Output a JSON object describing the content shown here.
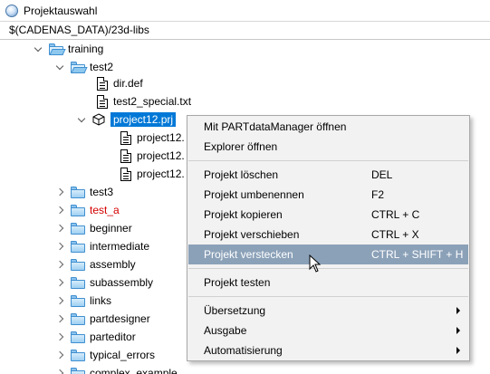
{
  "window": {
    "title": "Projektauswahl"
  },
  "path": "$(CADENAS_DATA)/23d-libs",
  "tree": {
    "training": "training",
    "test2": "test2",
    "files": [
      "dir.def",
      "test2_special.txt"
    ],
    "project": "project12.prj",
    "project_children": [
      "project12.",
      "project12.",
      "project12."
    ],
    "folders_after": [
      {
        "label": "test3",
        "color": "#000000"
      },
      {
        "label": "test_a",
        "color": "#d40000"
      },
      {
        "label": "beginner",
        "color": "#000000"
      },
      {
        "label": "intermediate",
        "color": "#000000"
      },
      {
        "label": "assembly",
        "color": "#000000"
      },
      {
        "label": "subassembly",
        "color": "#000000"
      },
      {
        "label": "links",
        "color": "#000000"
      },
      {
        "label": "partdesigner",
        "color": "#000000"
      },
      {
        "label": "parteditor",
        "color": "#000000"
      },
      {
        "label": "typical_errors",
        "color": "#000000"
      },
      {
        "label": "complex_example",
        "color": "#000000"
      }
    ]
  },
  "context_menu": {
    "group1": [
      {
        "label": "Mit PARTdataManager öffnen",
        "shortcut": ""
      },
      {
        "label": "Explorer öffnen",
        "shortcut": ""
      }
    ],
    "group2": [
      {
        "label": "Projekt löschen",
        "shortcut": "DEL"
      },
      {
        "label": "Projekt umbenennen",
        "shortcut": "F2"
      },
      {
        "label": "Projekt kopieren",
        "shortcut": "CTRL + C"
      },
      {
        "label": "Projekt verschieben",
        "shortcut": "CTRL + X"
      },
      {
        "label": "Projekt verstecken",
        "shortcut": "CTRL + SHIFT + H"
      }
    ],
    "group3": [
      {
        "label": "Projekt testen",
        "shortcut": ""
      }
    ],
    "group4": [
      {
        "label": "Übersetzung",
        "submenu": true
      },
      {
        "label": "Ausgabe",
        "submenu": true
      },
      {
        "label": "Automatisierung",
        "submenu": true
      }
    ],
    "hover_item": "Projekt verstecken",
    "hover_color": "#8ba1b8"
  },
  "colors": {
    "selection": "#0078d7",
    "error_text": "#d40000",
    "folder": "#9fd0f3"
  }
}
